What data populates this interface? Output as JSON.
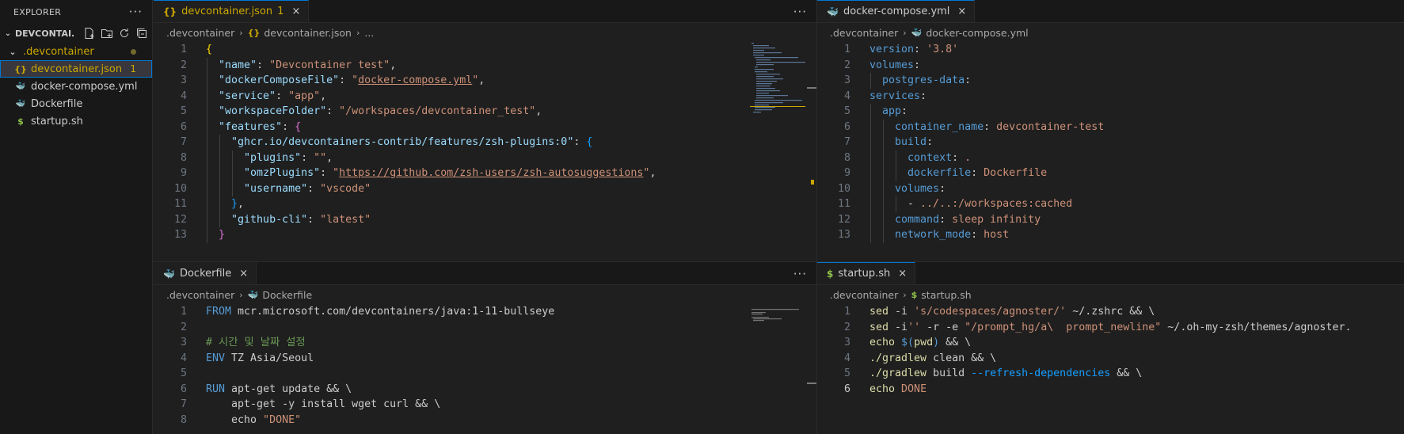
{
  "explorer": {
    "title": "EXPLORER",
    "more": "···",
    "folder": "DEVCONTAI...",
    "items": [
      {
        "label": ".devcontainer",
        "icon": "chevron-down",
        "indent": 1,
        "color": "#cca700"
      },
      {
        "label": "devcontainer.json",
        "icon": "{}",
        "indent": 2,
        "color": "#cca700",
        "badge": "1"
      },
      {
        "label": "docker-compose.yml",
        "icon": "docker",
        "indent": 2,
        "color": "#cccccc"
      },
      {
        "label": "Dockerfile",
        "icon": "docker",
        "indent": 2,
        "color": "#cccccc"
      },
      {
        "label": "startup.sh",
        "icon": "$",
        "indent": 2,
        "color": "#cccccc"
      }
    ]
  },
  "groups": {
    "devcontainer": {
      "tab": "devcontainer.json",
      "mod": "1",
      "crumb1": ".devcontainer",
      "crumb2": "devcontainer.json",
      "crumb3": "...",
      "more": "···"
    },
    "compose": {
      "tab": "docker-compose.yml",
      "crumb1": ".devcontainer",
      "crumb2": "docker-compose.yml",
      "more": ""
    },
    "dockerfile": {
      "tab": "Dockerfile",
      "crumb1": ".devcontainer",
      "crumb2": "Dockerfile",
      "more": "···"
    },
    "startup": {
      "tab": "startup.sh",
      "crumb1": ".devcontainer",
      "crumb2": "startup.sh",
      "more": ""
    }
  },
  "icons": {
    "close": "×",
    "chevron": "›",
    "json": "{}",
    "shell": "$",
    "docker": "docker-icon"
  },
  "colors": {
    "accent": "#0078d4",
    "modified": "#cca700",
    "docker": "#4aa5f0",
    "yml": "#e8507a",
    "shell": "#8dc149"
  },
  "code": {
    "devcontainer": [
      {
        "n": "1",
        "tokens": [
          [
            "b1",
            "{"
          ]
        ]
      },
      {
        "n": "2",
        "tokens": [
          [
            "p",
            "  "
          ],
          [
            "k",
            "\"name\""
          ],
          [
            "p",
            ": "
          ],
          [
            "s",
            "\"Devcontainer test\""
          ],
          [
            "p",
            ","
          ]
        ]
      },
      {
        "n": "3",
        "tokens": [
          [
            "p",
            "  "
          ],
          [
            "k",
            "\"dockerComposeFile\""
          ],
          [
            "p",
            ": "
          ],
          [
            "s",
            "\""
          ],
          [
            "sl",
            "docker-compose.yml"
          ],
          [
            "s",
            "\""
          ],
          [
            "p",
            ","
          ]
        ]
      },
      {
        "n": "4",
        "tokens": [
          [
            "p",
            "  "
          ],
          [
            "k",
            "\"service\""
          ],
          [
            "p",
            ": "
          ],
          [
            "s",
            "\"app\""
          ],
          [
            "p",
            ","
          ]
        ]
      },
      {
        "n": "5",
        "tokens": [
          [
            "p",
            "  "
          ],
          [
            "k",
            "\"workspaceFolder\""
          ],
          [
            "p",
            ": "
          ],
          [
            "s",
            "\"/workspaces/devcontainer_test\""
          ],
          [
            "p",
            ","
          ]
        ]
      },
      {
        "n": "6",
        "tokens": [
          [
            "p",
            "  "
          ],
          [
            "k",
            "\"features\""
          ],
          [
            "p",
            ": "
          ],
          [
            "b2",
            "{"
          ]
        ]
      },
      {
        "n": "7",
        "tokens": [
          [
            "p",
            "    "
          ],
          [
            "k",
            "\"ghcr.io/devcontainers-contrib/features/zsh-plugins:0\""
          ],
          [
            "p",
            ": "
          ],
          [
            "b3",
            "{"
          ]
        ]
      },
      {
        "n": "8",
        "tokens": [
          [
            "p",
            "      "
          ],
          [
            "k",
            "\"plugins\""
          ],
          [
            "p",
            ": "
          ],
          [
            "s",
            "\"\""
          ],
          [
            "p",
            ","
          ]
        ]
      },
      {
        "n": "9",
        "tokens": [
          [
            "p",
            "      "
          ],
          [
            "k",
            "\"omzPlugins\""
          ],
          [
            "p",
            ": "
          ],
          [
            "s",
            "\""
          ],
          [
            "sl",
            "https://github.com/zsh-users/zsh-autosuggestions"
          ],
          [
            "s",
            "\""
          ],
          [
            "p",
            ","
          ]
        ]
      },
      {
        "n": "10",
        "tokens": [
          [
            "p",
            "      "
          ],
          [
            "k",
            "\"username\""
          ],
          [
            "p",
            ": "
          ],
          [
            "s",
            "\"vscode\""
          ]
        ]
      },
      {
        "n": "11",
        "tokens": [
          [
            "p",
            "    "
          ],
          [
            "b3",
            "}"
          ],
          [
            "p",
            ","
          ]
        ]
      },
      {
        "n": "12",
        "tokens": [
          [
            "p",
            "    "
          ],
          [
            "k",
            "\"github-cli\""
          ],
          [
            "p",
            ": "
          ],
          [
            "s",
            "\"latest\""
          ]
        ]
      },
      {
        "n": "13",
        "tokens": [
          [
            "p",
            "  "
          ],
          [
            "b2",
            "}"
          ]
        ]
      }
    ],
    "compose": [
      {
        "n": "1",
        "tokens": [
          [
            "yk",
            "version"
          ],
          [
            "p",
            ": "
          ],
          [
            "s",
            "'3.8'"
          ]
        ]
      },
      {
        "n": "2",
        "tokens": [
          [
            "yk",
            "volumes"
          ],
          [
            "p",
            ":"
          ]
        ]
      },
      {
        "n": "3",
        "tokens": [
          [
            "p",
            "  "
          ],
          [
            "yk",
            "postgres-data"
          ],
          [
            "p",
            ":"
          ]
        ]
      },
      {
        "n": "4",
        "tokens": [
          [
            "yk",
            "services"
          ],
          [
            "p",
            ":"
          ]
        ]
      },
      {
        "n": "5",
        "tokens": [
          [
            "p",
            "  "
          ],
          [
            "yk",
            "app"
          ],
          [
            "p",
            ":"
          ]
        ]
      },
      {
        "n": "6",
        "tokens": [
          [
            "p",
            "    "
          ],
          [
            "yk",
            "container_name"
          ],
          [
            "p",
            ": "
          ],
          [
            "s",
            "devcontainer-test"
          ]
        ]
      },
      {
        "n": "7",
        "tokens": [
          [
            "p",
            "    "
          ],
          [
            "yk",
            "build"
          ],
          [
            "p",
            ":"
          ]
        ]
      },
      {
        "n": "8",
        "tokens": [
          [
            "p",
            "      "
          ],
          [
            "yk",
            "context"
          ],
          [
            "p",
            ": "
          ],
          [
            "s",
            "."
          ]
        ]
      },
      {
        "n": "9",
        "tokens": [
          [
            "p",
            "      "
          ],
          [
            "yk",
            "dockerfile"
          ],
          [
            "p",
            ": "
          ],
          [
            "s",
            "Dockerfile"
          ]
        ]
      },
      {
        "n": "10",
        "tokens": [
          [
            "p",
            "    "
          ],
          [
            "yk",
            "volumes"
          ],
          [
            "p",
            ":"
          ]
        ]
      },
      {
        "n": "11",
        "tokens": [
          [
            "p",
            "      - "
          ],
          [
            "s",
            "../..:/workspaces:cached"
          ]
        ]
      },
      {
        "n": "12",
        "tokens": [
          [
            "p",
            "    "
          ],
          [
            "yk",
            "command"
          ],
          [
            "p",
            ": "
          ],
          [
            "s",
            "sleep infinity"
          ]
        ]
      },
      {
        "n": "13",
        "tokens": [
          [
            "p",
            "    "
          ],
          [
            "yk",
            "network_mode"
          ],
          [
            "p",
            ": "
          ],
          [
            "s",
            "host"
          ]
        ]
      }
    ],
    "dockerfile": [
      {
        "n": "1",
        "tokens": [
          [
            "kw",
            "FROM"
          ],
          [
            "p",
            " mcr.microsoft.com/devcontainers/java:1-11-bullseye"
          ]
        ]
      },
      {
        "n": "2",
        "tokens": []
      },
      {
        "n": "3",
        "tokens": [
          [
            "cm",
            "# 시간 및 날짜 설정"
          ]
        ]
      },
      {
        "n": "4",
        "tokens": [
          [
            "kw",
            "ENV"
          ],
          [
            "p",
            " TZ Asia/Seoul"
          ]
        ]
      },
      {
        "n": "5",
        "tokens": []
      },
      {
        "n": "6",
        "tokens": [
          [
            "kw",
            "RUN"
          ],
          [
            "p",
            " apt-get update && \\"
          ]
        ]
      },
      {
        "n": "7",
        "tokens": [
          [
            "p",
            "    apt-get -y install wget curl && \\"
          ]
        ]
      },
      {
        "n": "8",
        "tokens": [
          [
            "p",
            "    echo "
          ],
          [
            "s",
            "\"DONE\""
          ]
        ]
      }
    ],
    "startup": [
      {
        "n": "1",
        "tokens": [
          [
            "fn",
            "sed"
          ],
          [
            "p",
            " -i "
          ],
          [
            "s",
            "'s/codespaces/agnoster/'"
          ],
          [
            "p",
            " ~/.zshrc && \\"
          ]
        ]
      },
      {
        "n": "2",
        "tokens": [
          [
            "fn",
            "sed"
          ],
          [
            "p",
            " -i"
          ],
          [
            "s",
            "''"
          ],
          [
            "p",
            " -r -e "
          ],
          [
            "s",
            "\"/prompt_hg/a\\  prompt_newline\""
          ],
          [
            "p",
            " ~/.oh-my-zsh/themes/agnoster."
          ]
        ]
      },
      {
        "n": "3",
        "tokens": [
          [
            "fn",
            "echo"
          ],
          [
            "p",
            " "
          ],
          [
            "kw",
            "$("
          ],
          [
            "fn",
            "pwd"
          ],
          [
            "kw",
            ")"
          ],
          [
            "p",
            " && \\"
          ]
        ]
      },
      {
        "n": "4",
        "tokens": [
          [
            "fn",
            "./gradlew"
          ],
          [
            "p",
            " clean && \\"
          ]
        ]
      },
      {
        "n": "5",
        "tokens": [
          [
            "fn",
            "./gradlew"
          ],
          [
            "p",
            " build "
          ],
          [
            "b3",
            "--refresh-dependencies"
          ],
          [
            "p",
            " && \\"
          ]
        ]
      },
      {
        "n": "6",
        "tokens": [
          [
            "fn",
            "echo"
          ],
          [
            "p",
            " "
          ],
          [
            "s",
            "DONE"
          ]
        ],
        "current": true
      }
    ]
  }
}
